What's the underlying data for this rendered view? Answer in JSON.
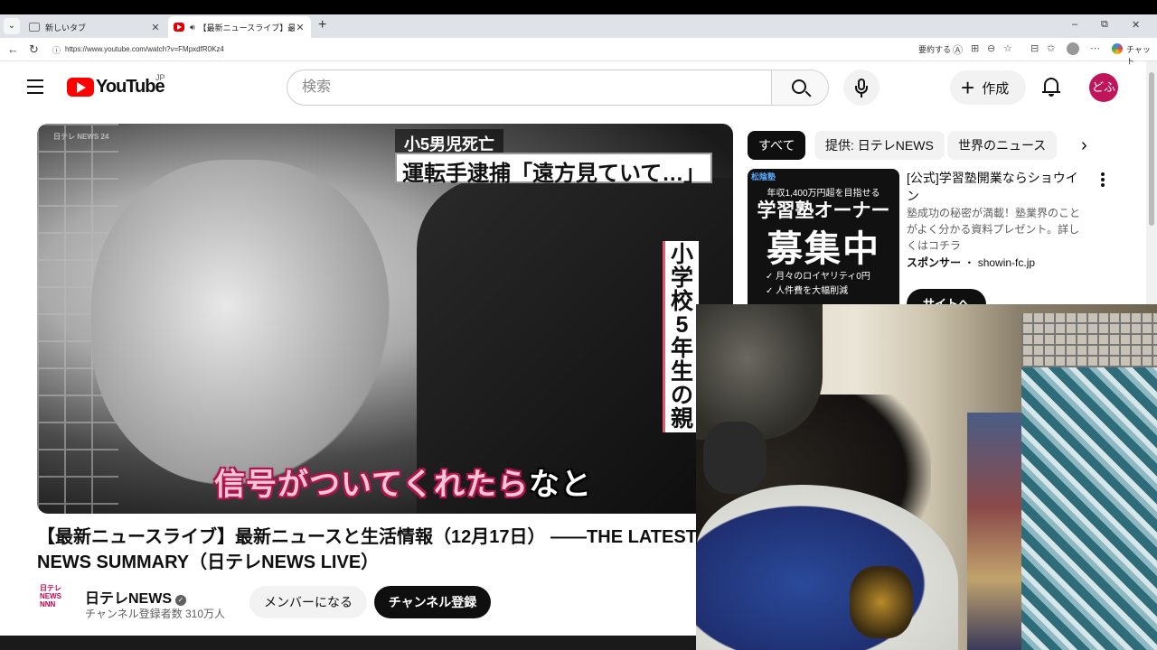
{
  "browser": {
    "tabs": [
      {
        "title": "新しいタブ",
        "active": false
      },
      {
        "title": "【最新ニュースライブ】最新ニュース",
        "active": true
      }
    ],
    "url": "https://www.youtube.com/watch?v=FMpxdfR0Kz4",
    "summarize_label": "要約する",
    "chat_label": "チャット",
    "window_controls": {
      "minimize": "–",
      "restore": "⧉",
      "close": "✕"
    }
  },
  "youtube": {
    "logo_text": "YouTube",
    "region": "JP",
    "search_placeholder": "検索",
    "create_label": "作成",
    "avatar_text": "どふ"
  },
  "video": {
    "title": "【最新ニュースライブ】最新ニュースと生活情報（12月17日） ――THE LATEST NEWS SUMMARY（日テレNEWS LIVE）",
    "caption_top": "小5男児死亡",
    "caption_main": "運転手逮捕「遠方見ていて…」",
    "caption_vertical": "小学校5年生の親",
    "subtitle_pink": "信号がついてくれたら",
    "subtitle_white": "なと",
    "corner_logo": "日テレ NEWS 24"
  },
  "channel": {
    "name": "日テレNEWS",
    "subscribers": "チャンネル登録者数 310万人",
    "logo_text": "日テレ NEWS NNN",
    "member_label": "メンバーになる",
    "subscribe_label": "チャンネル登録"
  },
  "chips": {
    "all": "すべて",
    "provider": "提供: 日テレNEWS",
    "world": "世界のニュース"
  },
  "ad": {
    "brand": "松陰塾",
    "line1": "年収1,400万円超を目指せる",
    "line2": "学習塾オーナー",
    "line3": "募集中",
    "line4": "✓ 月々のロイヤリティ0円",
    "line5": "✓ 人件費を大幅削減",
    "title": "[公式]学習塾開業ならショウイン",
    "description": "塾成功の秘密が満載！塾業界のことがよく分かる資料プレゼント。詳しくはコチラ",
    "sponsor_label": "スポンサー",
    "sponsor_site": "showin-fc.jp",
    "cta": "サイトへ"
  },
  "colors": {
    "yt_red": "#ff0000",
    "avatar": "#c0155a",
    "subscribe_bg": "#0f0f0f"
  }
}
